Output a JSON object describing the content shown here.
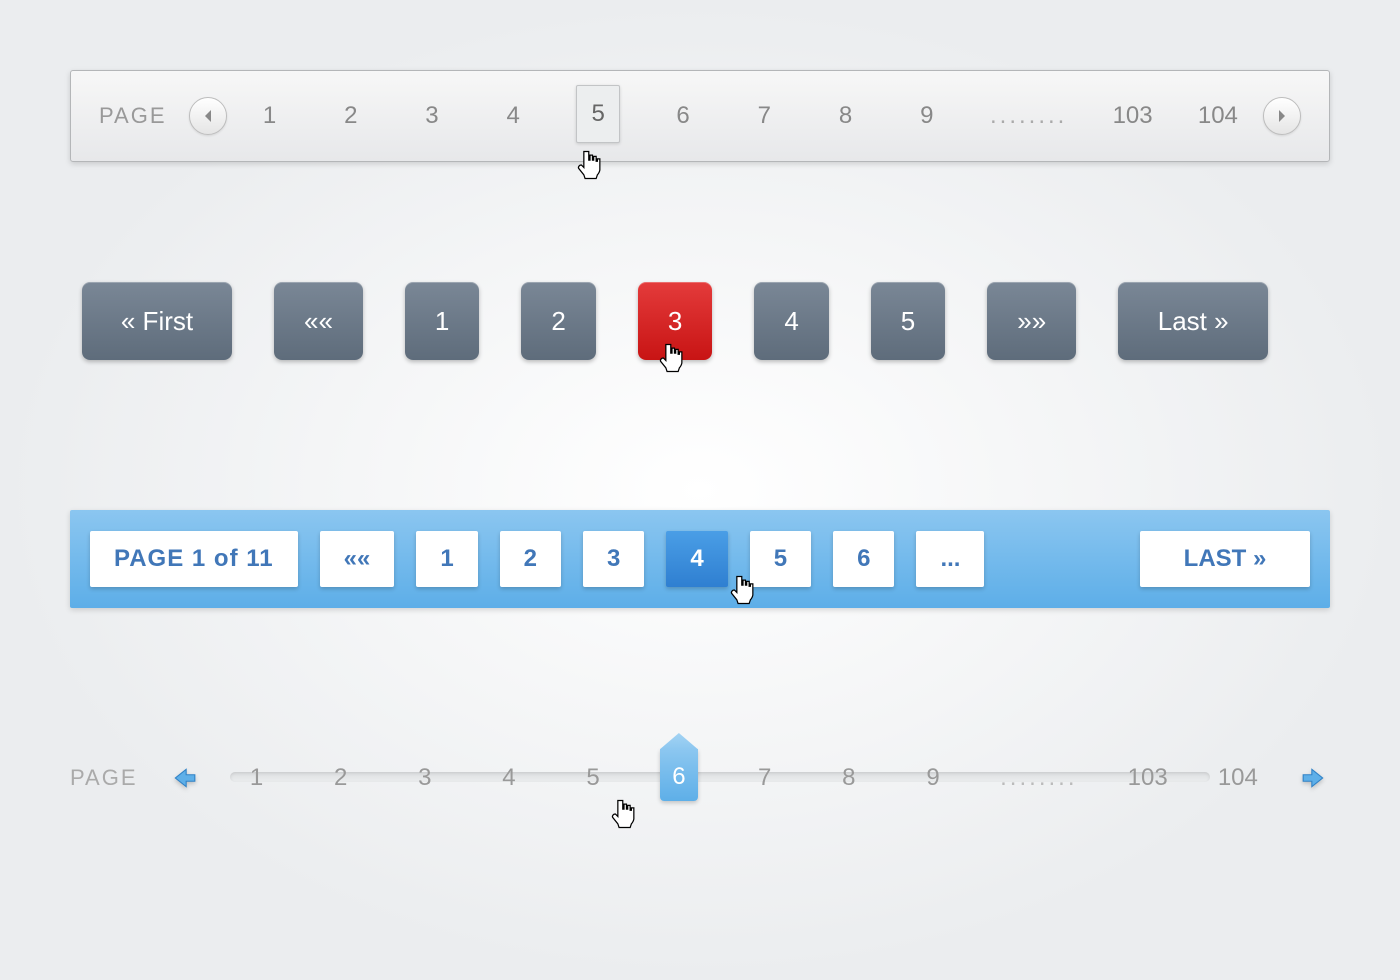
{
  "style1": {
    "label": "PAGE",
    "pages": [
      "1",
      "2",
      "3",
      "4",
      "5",
      "6",
      "7",
      "8",
      "9"
    ],
    "ellipsis": "........",
    "tail": [
      "103",
      "104"
    ],
    "active_index": 4
  },
  "style2": {
    "first": "« First",
    "prev": "««",
    "pages": [
      "1",
      "2",
      "3",
      "4",
      "5"
    ],
    "next": "»»",
    "last": "Last »",
    "active_index": 2
  },
  "style3": {
    "info": "PAGE 1 of 11",
    "prev": "««",
    "pages": [
      "1",
      "2",
      "3",
      "4",
      "5",
      "6"
    ],
    "ellipsis": "...",
    "last": "LAST  »",
    "active_index": 3
  },
  "style4": {
    "label": "PAGE",
    "pages": [
      "1",
      "2",
      "3",
      "4",
      "5",
      "6",
      "7",
      "8",
      "9"
    ],
    "ellipsis": "........",
    "tail": [
      "103",
      "104"
    ],
    "active_index": 5
  }
}
